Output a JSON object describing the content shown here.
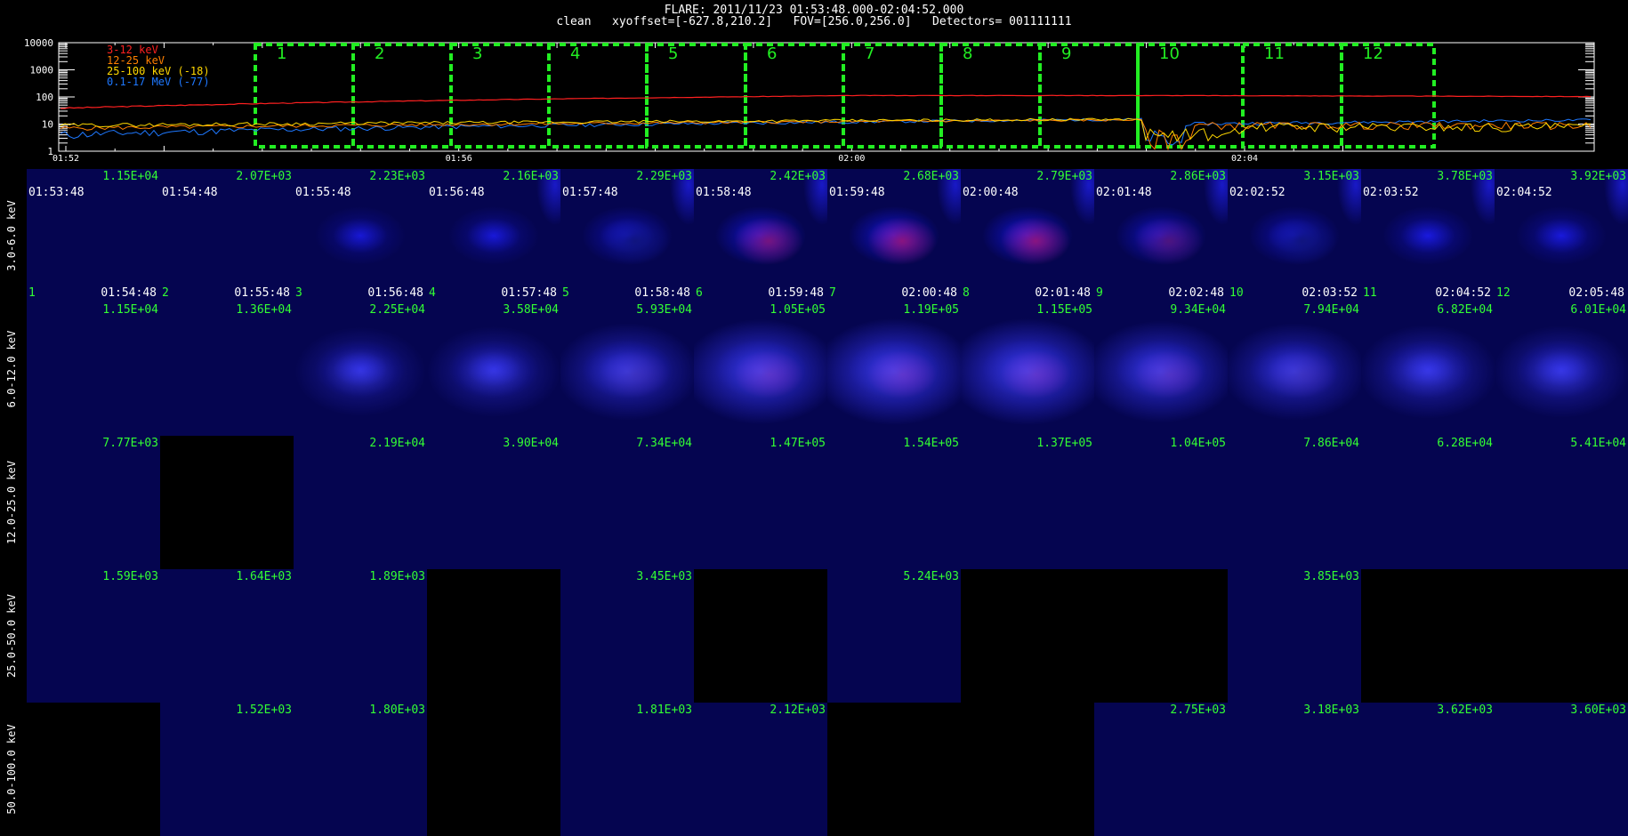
{
  "header": {
    "line1": "FLARE: 2011/11/23 01:53:48.000-02:04:52.000",
    "line2": "clean   xyoffset=[-627.8,210.2]   FOV=[256.0,256.0]   Detectors= 001111111"
  },
  "lightcurve": {
    "y_ticks": [
      "10000",
      "1000",
      "100",
      "10",
      "1"
    ],
    "x_ticks": [
      "01:52",
      "01:56",
      "02:00",
      "02:04"
    ],
    "legend": [
      {
        "label": "3-12 keV",
        "color": "#ff2020"
      },
      {
        "label": "12-25 keV",
        "color": "#ff7f00"
      },
      {
        "label": "25-100 keV (-18)",
        "color": "#ffd800"
      },
      {
        "label": "0.1-17 MeV (-77)",
        "color": "#1e78ff"
      }
    ],
    "interval_labels": [
      "1",
      "2",
      "3",
      "4",
      "5",
      "6",
      "7",
      "8",
      "9",
      "10",
      "11",
      "12"
    ],
    "interval_color": "#22ee22"
  },
  "grid": {
    "row_labels": [
      "3.0-6.0 keV",
      "6.0-12.0 keV",
      "12.0-25.0 keV",
      "25.0-50.0 keV",
      "50.0-100.0 keV"
    ],
    "start_times": [
      "01:53:48",
      "01:54:48",
      "01:55:48",
      "01:56:48",
      "01:57:48",
      "01:58:48",
      "01:59:48",
      "02:00:48",
      "02:01:48",
      "02:02:52",
      "02:03:52",
      "02:04:52"
    ],
    "end_times": [
      "01:54:48",
      "01:55:48",
      "01:56:48",
      "01:57:48",
      "01:58:48",
      "01:59:48",
      "02:00:48",
      "02:01:48",
      "02:02:48",
      "02:03:52",
      "02:04:52",
      "02:05:48"
    ],
    "index_labels": [
      "1",
      "2",
      "3",
      "4",
      "5",
      "6",
      "7",
      "8",
      "9",
      "10",
      "11",
      "12"
    ],
    "peaks": [
      [
        "1.15E+04",
        "2.07E+03",
        "2.23E+03",
        "2.16E+03",
        "2.29E+03",
        "2.42E+03",
        "2.68E+03",
        "2.79E+03",
        "2.86E+03",
        "3.15E+03",
        "3.78E+03",
        "3.92E+03"
      ],
      [
        "1.15E+04",
        "1.36E+04",
        "2.25E+04",
        "3.58E+04",
        "5.93E+04",
        "1.05E+05",
        "1.19E+05",
        "1.15E+05",
        "9.34E+04",
        "7.94E+04",
        "6.82E+04",
        "6.01E+04"
      ],
      [
        "7.77E+03",
        "",
        "2.19E+04",
        "3.90E+04",
        "7.34E+04",
        "1.47E+05",
        "1.54E+05",
        "1.37E+05",
        "1.04E+05",
        "7.86E+04",
        "6.28E+04",
        "5.41E+04"
      ],
      [
        "1.59E+03",
        "1.64E+03",
        "1.89E+03",
        "",
        "3.45E+03",
        "",
        "5.24E+03",
        "",
        "",
        "3.85E+03",
        "",
        ""
      ],
      [
        "",
        "1.52E+03",
        "1.80E+03",
        "",
        "1.81E+03",
        "2.12E+03",
        "",
        "",
        "2.75E+03",
        "3.18E+03",
        "3.62E+03",
        "3.60E+03"
      ]
    ],
    "empty_axis_ticks": [
      "2",
      "4",
      "6",
      "8"
    ],
    "colors": {
      "peak_label": "#33ff33",
      "grid_tick": "#ffffff",
      "empty_axis": "#ff5a1e",
      "map_background": "#050550"
    }
  }
}
